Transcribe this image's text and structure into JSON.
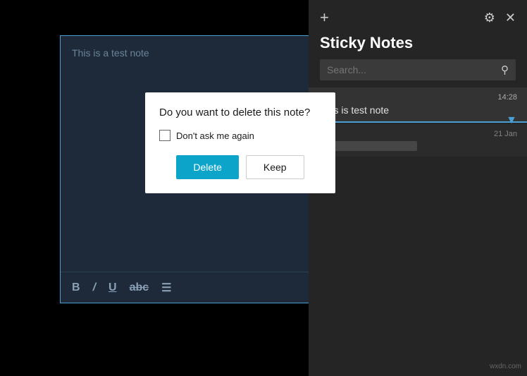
{
  "note_editor": {
    "placeholder": "This is a test note",
    "border_color": "#4a9fd4",
    "background": "#1e2a3a"
  },
  "delete_dialog": {
    "title": "Do you want to delete this note?",
    "checkbox_label": "Don't ask me again",
    "delete_button": "Delete",
    "keep_button": "Keep"
  },
  "toolbar": {
    "bold": "B",
    "italic": "/",
    "underline": "U",
    "strikethrough": "abc",
    "list": "☰"
  },
  "sticky_panel": {
    "title": "Sticky Notes",
    "search_placeholder": "Search...",
    "add_icon": "+",
    "settings_icon": "⚙",
    "close_icon": "✕",
    "search_icon": "🔍",
    "notes": [
      {
        "time": "14:28",
        "text": "This is test note",
        "active": true
      },
      {
        "date": "21 Jan",
        "text": "",
        "blurred": true
      }
    ]
  },
  "watermark": "wxdn.com"
}
